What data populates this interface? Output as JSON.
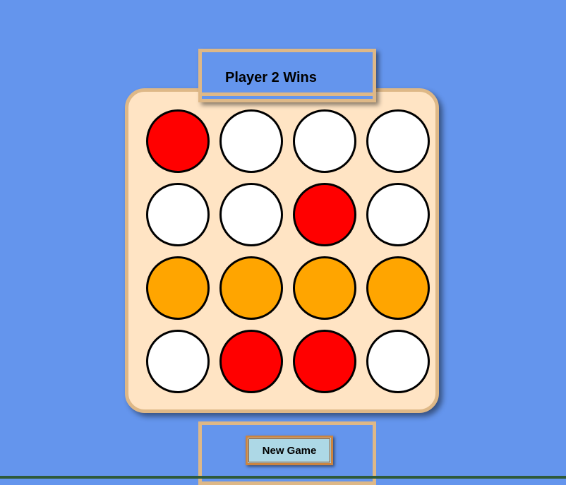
{
  "status": {
    "text": "Player 2 Wins"
  },
  "board": {
    "rows": 4,
    "cols": 4,
    "cells": [
      [
        "red",
        "empty",
        "empty",
        "empty"
      ],
      [
        "empty",
        "empty",
        "red",
        "empty"
      ],
      [
        "orange",
        "orange",
        "orange",
        "orange"
      ],
      [
        "empty",
        "red",
        "red",
        "empty"
      ]
    ]
  },
  "colors": {
    "background": "#6495ed",
    "frame": "#deb887",
    "board_fill": "#ffe4c4",
    "empty": "#ffffff",
    "red": "#ff0000",
    "orange": "#ffa500",
    "button_fill": "#add8e6",
    "button_border": "#cd853f"
  },
  "controls": {
    "new_game_label": "New Game"
  }
}
